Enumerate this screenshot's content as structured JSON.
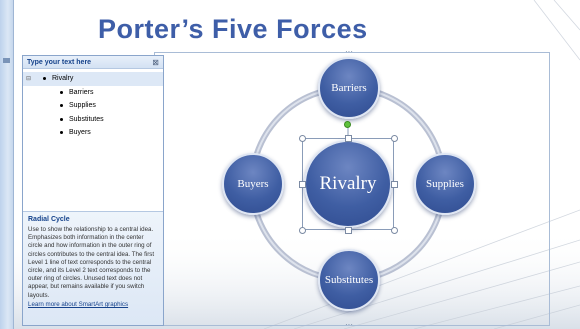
{
  "slide": {
    "title": "Porter’s Five Forces"
  },
  "smartart": {
    "layout_name": "Radial Cycle",
    "center": "Rivalry",
    "outer": {
      "top": "Barriers",
      "right": "Supplies",
      "bottom": "Substitutes",
      "left": "Buyers"
    },
    "colors": {
      "node_fill": "#3f5ea3",
      "ring": "#b9c0d2",
      "title": "#3e5ea8"
    }
  },
  "text_pane": {
    "header": "Type your text here",
    "close_icon": "close-icon",
    "items": [
      {
        "level": 1,
        "text": "Rivalry"
      },
      {
        "level": 2,
        "text": "Barriers"
      },
      {
        "level": 2,
        "text": "Supplies"
      },
      {
        "level": 2,
        "text": "Substitutes"
      },
      {
        "level": 2,
        "text": "Buyers"
      }
    ],
    "description": {
      "title": "Radial Cycle",
      "body": "Use to show the relationship to a central idea. Emphasizes both information in the center circle and how information in the outer ring of circles contributes to the central idea. The first Level 1 line of text corresponds to the central circle, and its Level 2 text corresponds to the outer ring of circles. Unused text does not appear, but remains available if you switch layouts.",
      "link": "Learn more about SmartArt graphics"
    }
  }
}
